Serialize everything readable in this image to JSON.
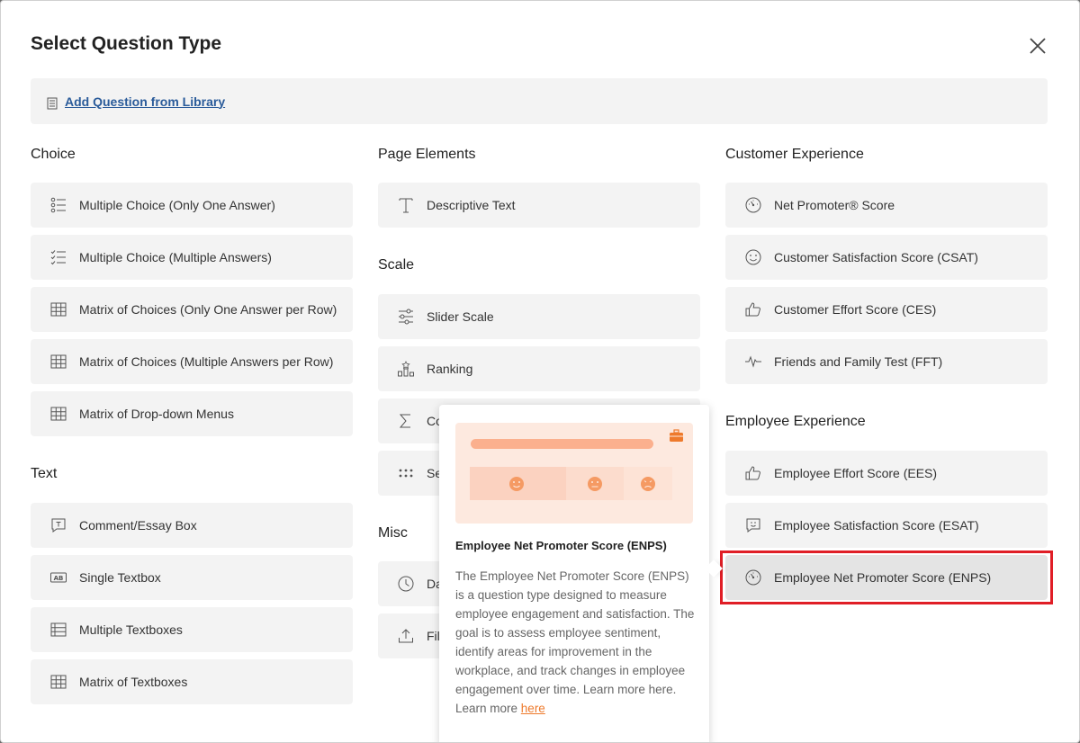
{
  "dialog": {
    "title": "Select Question Type",
    "library_link": "Add Question from Library"
  },
  "choice": {
    "heading": "Choice",
    "items": [
      {
        "label": "Multiple Choice (Only One Answer)",
        "icon": "radio-list-icon"
      },
      {
        "label": "Multiple Choice (Multiple Answers)",
        "icon": "checklist-icon"
      },
      {
        "label": "Matrix of Choices (Only One Answer per Row)",
        "icon": "grid-icon"
      },
      {
        "label": "Matrix of Choices (Multiple Answers per Row)",
        "icon": "grid-icon"
      },
      {
        "label": "Matrix of Drop-down Menus",
        "icon": "grid-icon"
      }
    ]
  },
  "text": {
    "heading": "Text",
    "items": [
      {
        "label": "Comment/Essay Box",
        "icon": "comment-icon"
      },
      {
        "label": "Single Textbox",
        "icon": "textbox-icon"
      },
      {
        "label": "Multiple Textboxes",
        "icon": "rows-icon"
      },
      {
        "label": "Matrix of Textboxes",
        "icon": "grid-icon"
      }
    ]
  },
  "page_elements": {
    "heading": "Page Elements",
    "items": [
      {
        "label": "Descriptive Text",
        "icon": "text-t-icon"
      }
    ]
  },
  "scale": {
    "heading": "Scale",
    "items": [
      {
        "label": "Slider Scale",
        "icon": "sliders-icon"
      },
      {
        "label": "Ranking",
        "icon": "ranking-icon"
      },
      {
        "label": "Co",
        "icon": "sigma-icon"
      },
      {
        "label": "Se",
        "icon": "dots-icon"
      }
    ]
  },
  "misc": {
    "heading": "Misc",
    "items": [
      {
        "label": "Da",
        "icon": "clock-icon"
      },
      {
        "label": "Fil",
        "icon": "upload-icon"
      }
    ]
  },
  "customer_experience": {
    "heading": "Customer Experience",
    "items": [
      {
        "label": "Net Promoter® Score",
        "icon": "gauge-icon"
      },
      {
        "label": "Customer Satisfaction Score (CSAT)",
        "icon": "smiley-icon"
      },
      {
        "label": "Customer Effort Score (CES)",
        "icon": "thumbs-up-icon"
      },
      {
        "label": "Friends and Family Test (FFT)",
        "icon": "pulse-icon"
      }
    ]
  },
  "employee_experience": {
    "heading": "Employee Experience",
    "items": [
      {
        "label": "Employee Effort Score (EES)",
        "icon": "thumbs-up-icon"
      },
      {
        "label": "Employee Satisfaction Score (ESAT)",
        "icon": "chat-smiley-icon"
      },
      {
        "label": "Employee Net Promoter Score (ENPS)",
        "icon": "gauge-icon"
      }
    ]
  },
  "tooltip": {
    "title": "Employee Net Promoter Score (ENPS)",
    "description": "The Employee Net Promoter Score (ENPS) is a question type designed to measure employee engagement and satisfaction. The goal is to assess employee sentiment, identify areas for improvement in the workplace, and track changes in employee engagement over time. Learn more here. Learn more ",
    "link": "here"
  },
  "colors": {
    "accent_orange": "#ee7a2c",
    "link_blue": "#2a5b9a",
    "selection_red": "#e01e26"
  }
}
